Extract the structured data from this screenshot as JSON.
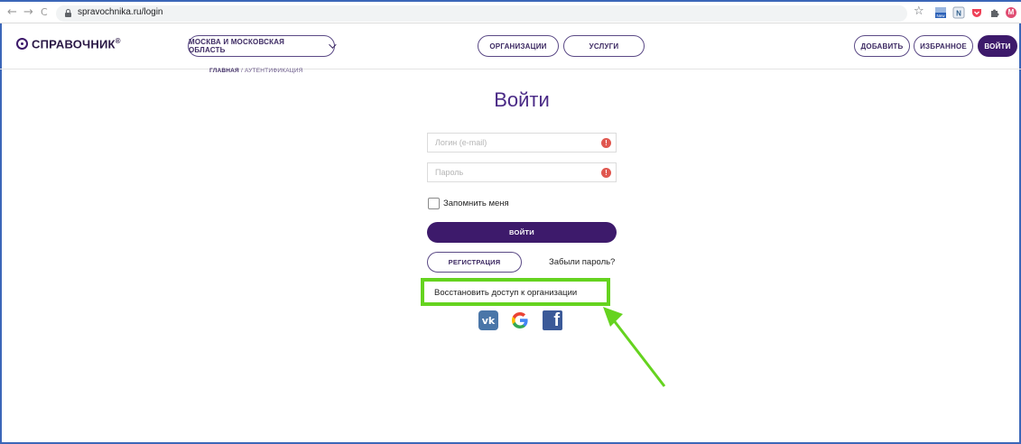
{
  "browser": {
    "back_glyph": "←",
    "forward_glyph": "→",
    "reload_glyph": "C",
    "url": "spravochnika.ru/login",
    "star_glyph": "☆",
    "extensions": [
      "new-extension-icon",
      "n-extension-icon",
      "pocket-icon",
      "puzzle-icon",
      "profile-avatar"
    ],
    "profile_letter": "M"
  },
  "header": {
    "logo_text": "СПРАВОЧНИК",
    "logo_mark": "®",
    "region_label": "МОСКВА И МОСКОВСКАЯ ОБЛАСТЬ",
    "nav": {
      "organizations": "ОРГАНИЗАЦИИ",
      "services": "УСЛУГИ"
    },
    "actions": {
      "add": "ДОБАВИТЬ",
      "favorites": "ИЗБРАННОЕ",
      "login": "ВОЙТИ"
    }
  },
  "breadcrumb": {
    "home": "ГЛАВНАЯ",
    "separator": " / ",
    "current": "АУТЕНТИФИКАЦИЯ"
  },
  "login": {
    "title": "Войти",
    "login_placeholder": "Логин (e-mail)",
    "password_placeholder": "Пароль",
    "warning_glyph": "!",
    "remember_label": "Запомнить меня",
    "submit_label": "ВОЙТИ",
    "register_label": "РЕГИСТРАЦИЯ",
    "forgot_label": "Забыли пароль?",
    "restore_label": "Восстановить доступ к организации",
    "social": {
      "vk": "vk",
      "google": "G",
      "facebook": "f"
    }
  },
  "colors": {
    "brand": "#3d1a6b",
    "title": "#4a2a86",
    "highlight": "#65d31f",
    "warning": "#e0574f",
    "vk": "#4a76a8",
    "facebook": "#3b5998"
  }
}
